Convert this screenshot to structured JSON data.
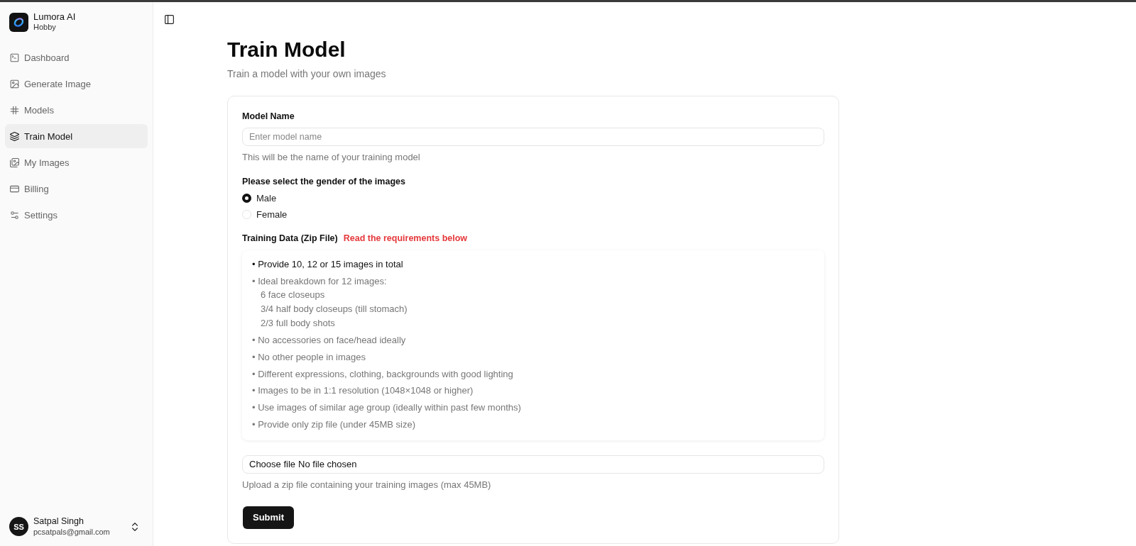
{
  "sidebar": {
    "brand": {
      "name": "Lumora AI",
      "plan": "Hobby"
    },
    "nav": [
      {
        "label": "Dashboard",
        "selected": false
      },
      {
        "label": "Generate Image",
        "selected": false
      },
      {
        "label": "Models",
        "selected": false
      },
      {
        "label": "Train Model",
        "selected": true
      },
      {
        "label": "My Images",
        "selected": false
      },
      {
        "label": "Billing",
        "selected": false
      },
      {
        "label": "Settings",
        "selected": false
      }
    ],
    "user": {
      "initials": "SS",
      "name": "Satpal Singh",
      "email": "pcsatpals@gmail.com"
    }
  },
  "page": {
    "title": "Train Model",
    "subtitle": "Train a model with your own images"
  },
  "form": {
    "model_name": {
      "label": "Model Name",
      "placeholder": "Enter model name",
      "hint": "This will be the name of your training model"
    },
    "gender": {
      "label": "Please select the gender of the images",
      "options": [
        {
          "label": "Male",
          "selected": true
        },
        {
          "label": "Female",
          "selected": false
        }
      ]
    },
    "training_data": {
      "label": "Training Data (Zip File)",
      "note": "Read the requirements below",
      "requirements": [
        {
          "text": "• Provide 10, 12 or 15 images in total",
          "highlighted": true
        },
        {
          "text": "• Ideal breakdown for 12 images:",
          "highlighted": false,
          "details": [
            "6 face closeups",
            "3/4 half body closeups (till stomach)",
            "2/3 full body shots"
          ]
        },
        {
          "text": "• No accessories on face/head ideally",
          "highlighted": false
        },
        {
          "text": "• No other people in images",
          "highlighted": false
        },
        {
          "text": "• Different expressions, clothing, backgrounds with good lighting",
          "highlighted": false
        },
        {
          "text": "• Images to be in 1:1 resolution (1048×1048 or higher)",
          "highlighted": false
        },
        {
          "text": "• Use images of similar age group (ideally within past few months)",
          "highlighted": false
        },
        {
          "text": "• Provide only zip file (under 45MB size)",
          "highlighted": false
        }
      ]
    },
    "file": {
      "button": "Choose file",
      "status": "No file chosen",
      "hint": "Upload a zip file containing your training images (max 45MB)"
    },
    "submit": "Submit"
  }
}
